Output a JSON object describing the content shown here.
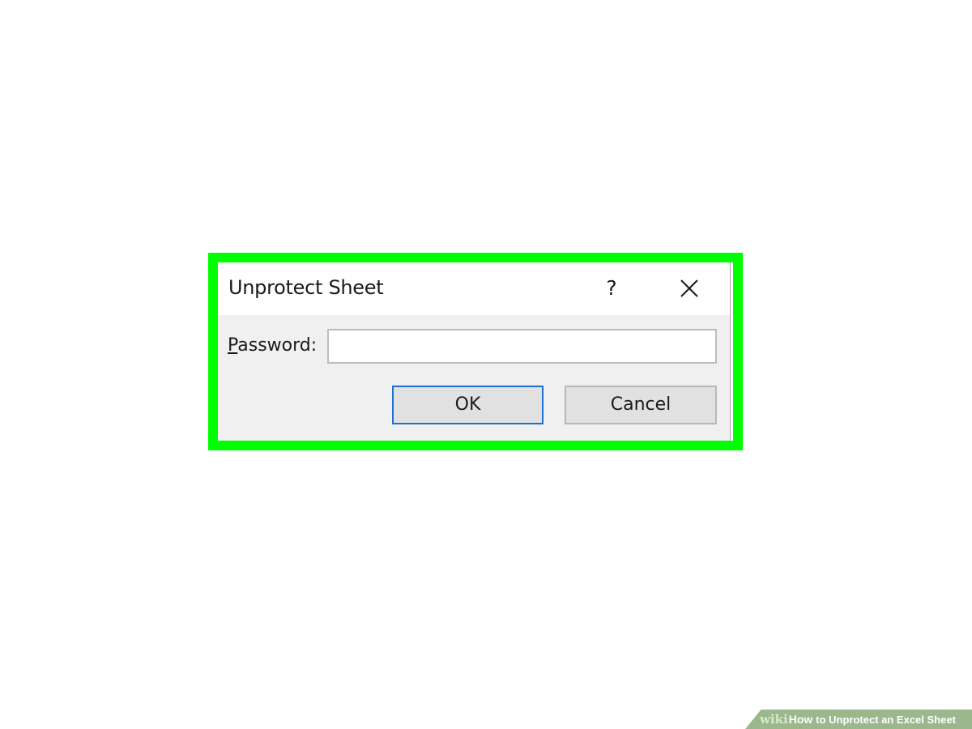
{
  "highlight": {
    "color": "#00ff00"
  },
  "dialog": {
    "title": "Unprotect Sheet",
    "help_icon": "question-mark-icon",
    "help_label": "?",
    "close_icon": "close-icon",
    "password_label_accel": "P",
    "password_label_rest": "assword:",
    "password_value": "",
    "ok_label": "OK",
    "cancel_label": "Cancel",
    "ok_focus_color": "#1e6fd0"
  },
  "watermark": {
    "logo": "wiki",
    "how": "How",
    "title": "to Unprotect an Excel Sheet"
  }
}
